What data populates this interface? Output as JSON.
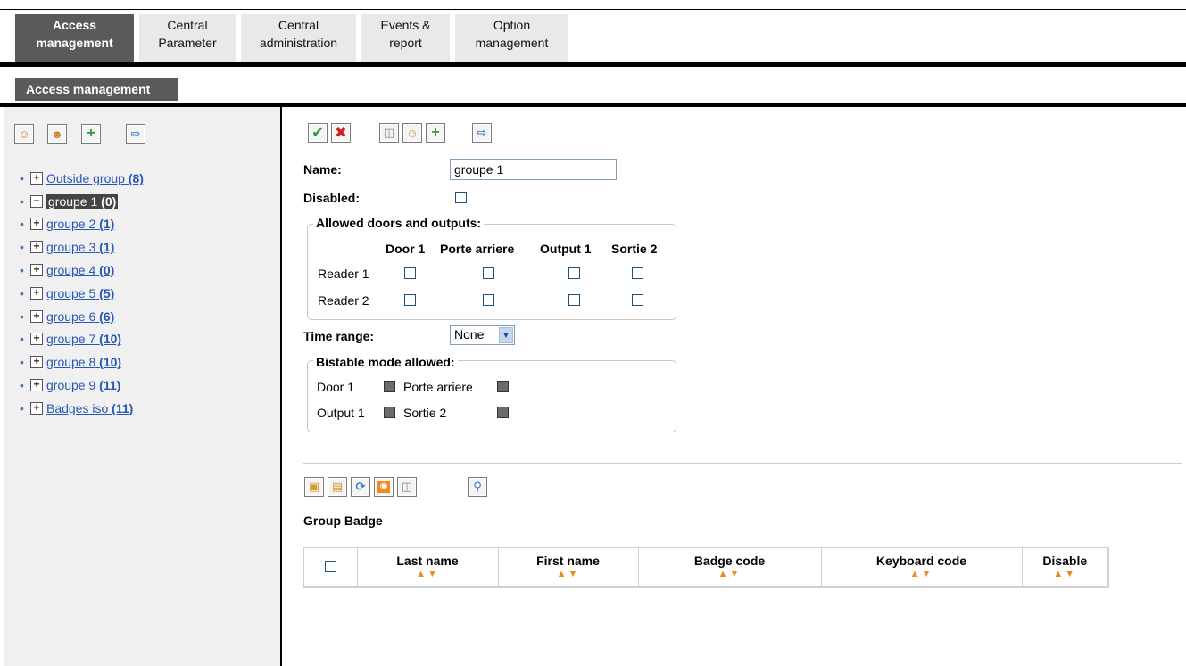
{
  "tabs": [
    {
      "line1": "Access",
      "line2": "management",
      "active": true
    },
    {
      "line1": "Central",
      "line2": "Parameter"
    },
    {
      "line1": "Central",
      "line2": "administration"
    },
    {
      "line1": "Events &",
      "line2": "report"
    },
    {
      "line1": "Option",
      "line2": "management"
    }
  ],
  "subtab": "Access management",
  "tree": [
    {
      "label": "Outside group",
      "count": "(8)",
      "expanded": false
    },
    {
      "label": "groupe 1",
      "count": "(0)",
      "expanded": true,
      "selected": true
    },
    {
      "label": "groupe 2",
      "count": "(1)"
    },
    {
      "label": "groupe 3",
      "count": "(1)"
    },
    {
      "label": "groupe 4",
      "count": "(0)"
    },
    {
      "label": "groupe 5",
      "count": "(5)"
    },
    {
      "label": "groupe 6",
      "count": "(6)"
    },
    {
      "label": "groupe 7",
      "count": "(10)"
    },
    {
      "label": "groupe 8",
      "count": "(10)"
    },
    {
      "label": "groupe 9",
      "count": "(11)"
    },
    {
      "label": "Badges iso",
      "count": "(11)"
    }
  ],
  "form": {
    "name_label": "Name:",
    "name_value": "groupe 1",
    "disabled_label": "Disabled:",
    "doors_legend": "Allowed doors and outputs:",
    "columns": [
      "Door 1",
      "Porte arriere",
      "Output 1",
      "Sortie 2"
    ],
    "rows": [
      "Reader 1",
      "Reader 2"
    ],
    "time_range_label": "Time range:",
    "time_range_value": "None",
    "bistable_legend": "Bistable mode allowed:",
    "bistable": {
      "door1": "Door 1",
      "porte": "Porte arriere",
      "output1": "Output 1",
      "sortie2": "Sortie 2"
    }
  },
  "badge": {
    "title": "Group Badge",
    "columns": [
      "Last name",
      "First name",
      "Badge code",
      "Keyboard code",
      "Disable"
    ],
    "sort_glyphs": "▲▼"
  },
  "icons": {
    "left_toolbar": [
      "add-user-icon",
      "group-users-icon",
      "add-item-icon",
      "export-icon"
    ],
    "form_toolbar": [
      "check-icon",
      "close-icon",
      "trash-icon",
      "add-user-icon",
      "add-item-icon",
      "export-icon"
    ],
    "badge_toolbar": [
      "lock-icon",
      "unlock-icon",
      "refresh-icon",
      "rss-icon",
      "trash-icon",
      "search-icon"
    ]
  }
}
